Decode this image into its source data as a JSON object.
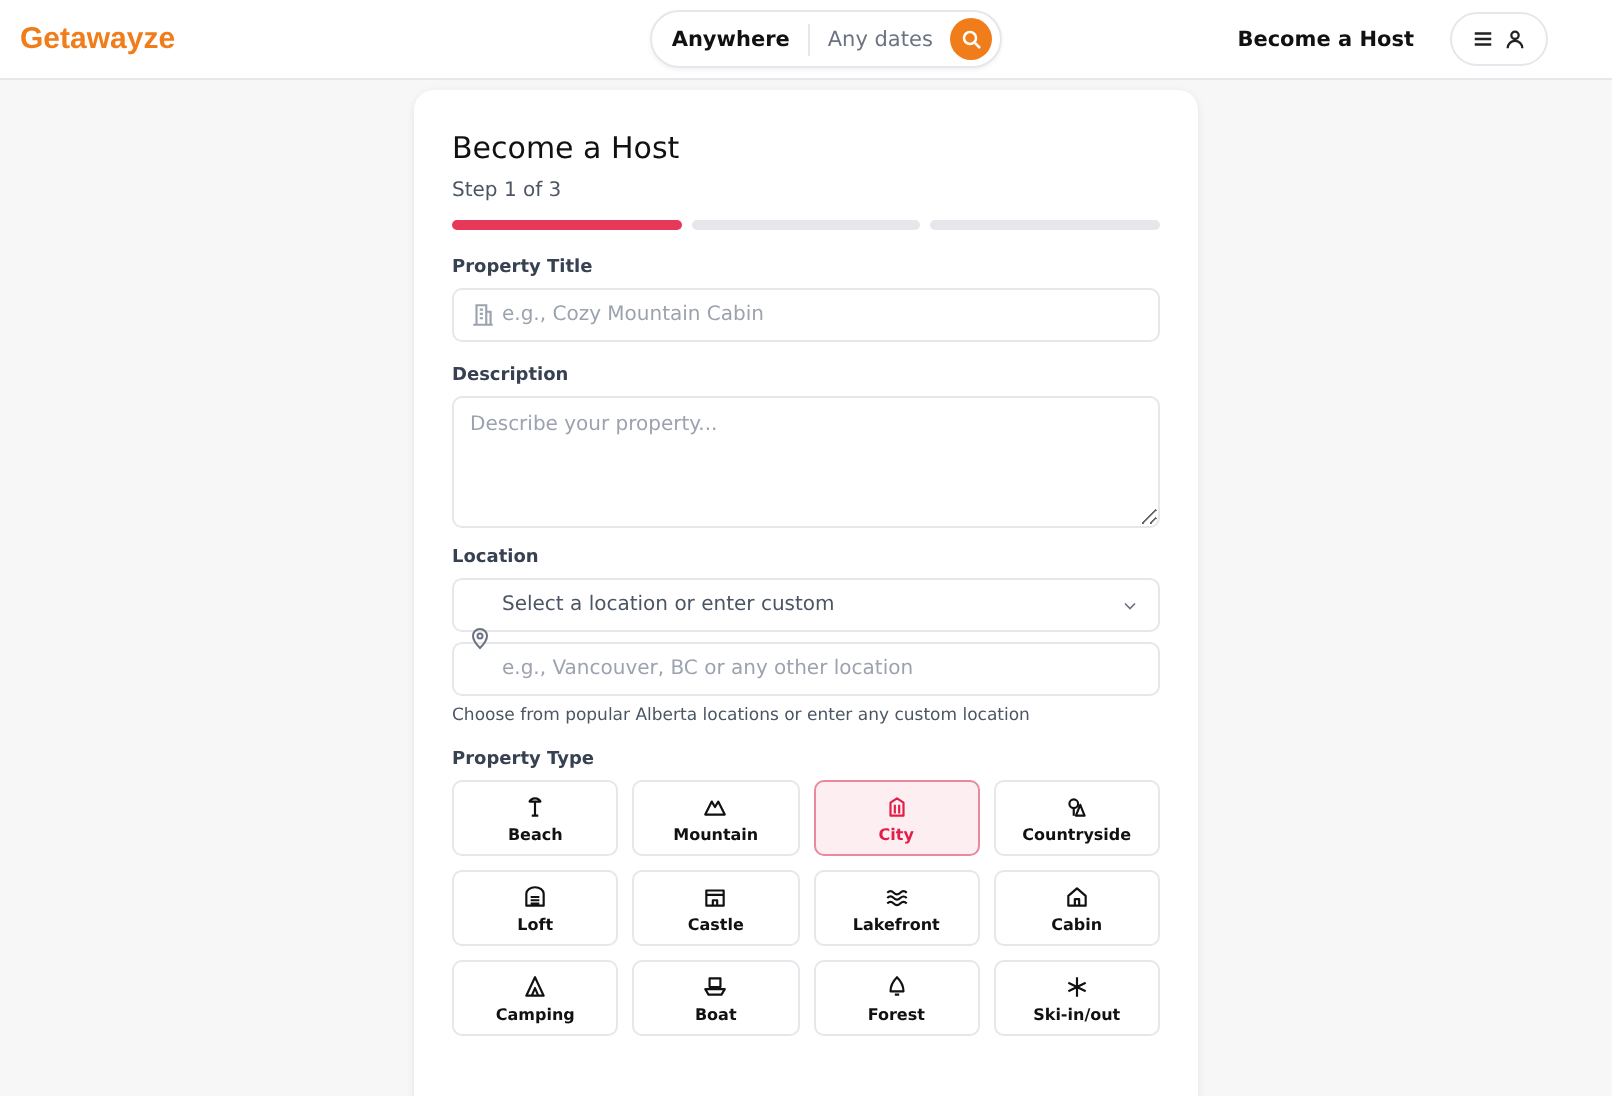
{
  "header": {
    "logo": "Getawayze",
    "search": {
      "location": "Anywhere",
      "dates": "Any dates"
    },
    "host_link": "Become a Host"
  },
  "form": {
    "title": "Become a Host",
    "step_text": "Step 1 of 3",
    "steps": [
      {
        "done": true
      },
      {
        "done": false
      },
      {
        "done": false
      }
    ],
    "property_title": {
      "label": "Property Title",
      "placeholder": "e.g., Cozy Mountain Cabin"
    },
    "description": {
      "label": "Description",
      "placeholder": "Describe your property..."
    },
    "location": {
      "label": "Location",
      "select_placeholder": "Select a location or enter custom",
      "custom_placeholder": "e.g., Vancouver, BC or any other location",
      "help": "Choose from popular Alberta locations or enter any custom location"
    },
    "property_type": {
      "label": "Property Type",
      "options": [
        {
          "label": "Beach",
          "selected": false
        },
        {
          "label": "Mountain",
          "selected": false
        },
        {
          "label": "City",
          "selected": true
        },
        {
          "label": "Countryside",
          "selected": false
        },
        {
          "label": "Loft",
          "selected": false
        },
        {
          "label": "Castle",
          "selected": false
        },
        {
          "label": "Lakefront",
          "selected": false
        },
        {
          "label": "Cabin",
          "selected": false
        },
        {
          "label": "Camping",
          "selected": false
        },
        {
          "label": "Boat",
          "selected": false
        },
        {
          "label": "Forest",
          "selected": false
        },
        {
          "label": "Ski-in/out",
          "selected": false
        }
      ]
    }
  }
}
